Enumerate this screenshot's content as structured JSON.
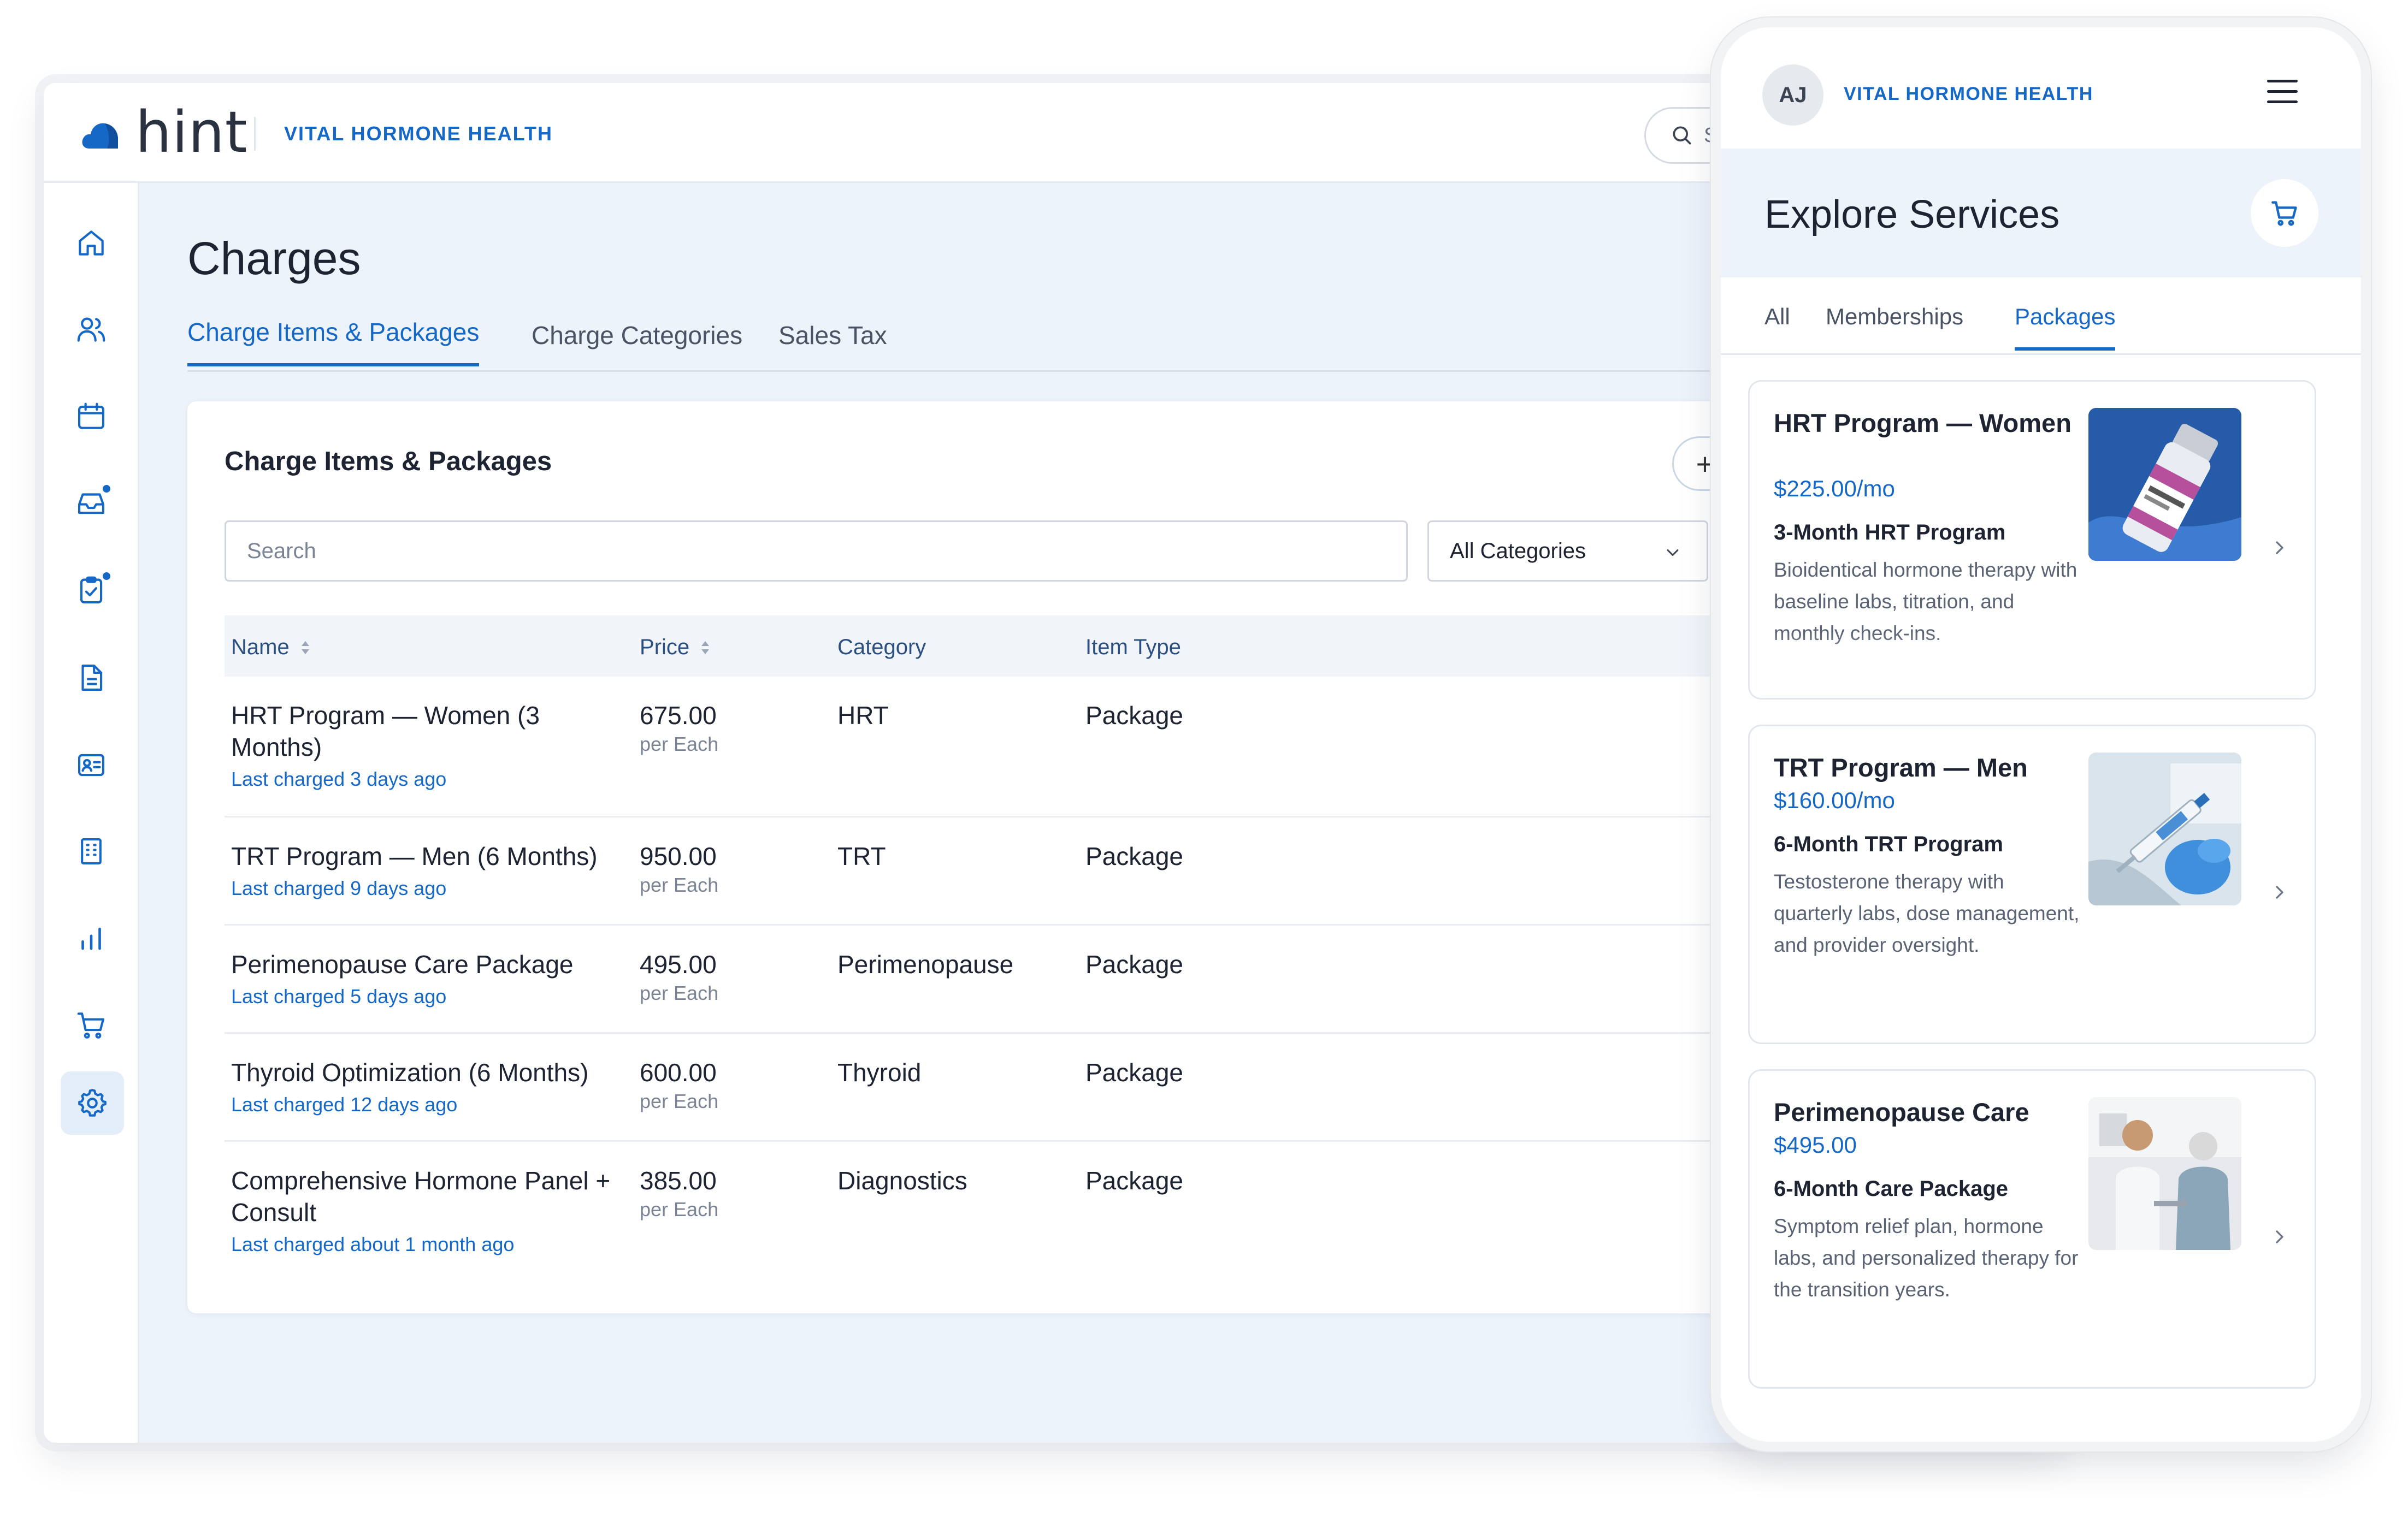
{
  "desktop": {
    "brand": {
      "logo_text": "hint",
      "org_name": "VITAL HORMONE HEALTH"
    },
    "top_search": {
      "placeholder_fragment": "S"
    },
    "sidebar": {
      "items": [
        "home-icon",
        "users-icon",
        "calendar-icon",
        "inbox-icon",
        "tasks-icon",
        "document-icon",
        "id-card-icon",
        "building-icon",
        "chart-icon",
        "cart-icon",
        "gear-icon"
      ],
      "active": "gear-icon",
      "bottom": "user-circle-icon"
    },
    "page_title": "Charges",
    "tabs": [
      {
        "label": "Charge Items & Packages",
        "active": true
      },
      {
        "label": "Charge Categories",
        "active": false
      },
      {
        "label": "Sales Tax",
        "active": false
      }
    ],
    "card": {
      "title": "Charge Items & Packages",
      "add_label": "+",
      "search_placeholder": "Search",
      "category_filter": "All Categories",
      "columns": {
        "name": "Name",
        "price": "Price",
        "category": "Category",
        "item_type": "Item Type"
      },
      "rows": [
        {
          "name_line1": "HRT Program — Women (3",
          "name_line2": "Months)",
          "last_charged": "Last charged 3 days ago",
          "price": "675.00",
          "unit": "per Each",
          "category": "HRT",
          "item_type": "Package"
        },
        {
          "name_line1": "TRT Program — Men (6 Months)",
          "name_line2": "",
          "last_charged": "Last charged 9 days ago",
          "price": "950.00",
          "unit": "per Each",
          "category": "TRT",
          "item_type": "Package"
        },
        {
          "name_line1": "Perimenopause Care Package",
          "name_line2": "",
          "last_charged": "Last charged 5 days ago",
          "price": "495.00",
          "unit": "per Each",
          "category": "Perimenopause",
          "item_type": "Package"
        },
        {
          "name_line1": "Thyroid Optimization (6 Months)",
          "name_line2": "",
          "last_charged": "Last charged 12 days ago",
          "price": "600.00",
          "unit": "per Each",
          "category": "Thyroid",
          "item_type": "Package"
        },
        {
          "name_line1": "Comprehensive Hormone Panel +",
          "name_line2": "Consult",
          "last_charged": "Last charged about 1 month ago",
          "price": "385.00",
          "unit": "per Each",
          "category": "Diagnostics",
          "item_type": "Package"
        }
      ]
    }
  },
  "phone": {
    "avatar_initials": "AJ",
    "org_name": "VITAL HORMONE HEALTH",
    "title": "Explore Services",
    "tabs": [
      {
        "label": "All",
        "active": false
      },
      {
        "label": "Memberships",
        "active": false
      },
      {
        "label": "Packages",
        "active": true
      }
    ],
    "services": [
      {
        "title": "HRT Program — Women",
        "price": "$225.00/mo",
        "subtitle": "3-Month HRT Program",
        "description": "Bioidentical hormone therapy with baseline labs, titration, and monthly check-ins.",
        "image": "vial-image"
      },
      {
        "title": "TRT Program — Men",
        "price": "$160.00/mo",
        "subtitle": "6-Month TRT Program",
        "description": "Testosterone therapy with quarterly labs, dose management, and provider oversight.",
        "image": "syringe-image"
      },
      {
        "title": "Perimenopause Care",
        "price": "$495.00",
        "subtitle": "6-Month Care Package",
        "description": "Symptom relief plan, hormone labs, and personalized therapy for the transition years.",
        "image": "clinic-image"
      }
    ]
  },
  "colors": {
    "accent": "#1668c7",
    "band": "#edf3fb",
    "text": "#1d2331"
  }
}
